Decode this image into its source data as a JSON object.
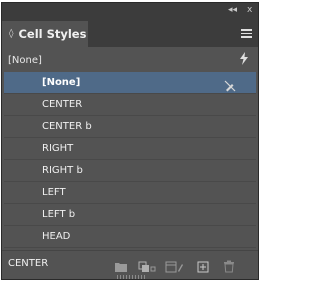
{
  "panel": {
    "title": "Cell Styles",
    "collapse_glyph": "◊",
    "topbar_collapse": "◂◂",
    "topbar_close": "x",
    "menu_icon": "panel-menu-icon"
  },
  "current_style": {
    "label": "[None]",
    "icon": "lightning-icon"
  },
  "styles": [
    {
      "label": "[None]",
      "selected": true,
      "icon": "pencil-disabled-icon"
    },
    {
      "label": "CENTER"
    },
    {
      "label": "CENTER b"
    },
    {
      "label": "RIGHT"
    },
    {
      "label": "RIGHT b"
    },
    {
      "label": "LEFT"
    },
    {
      "label": "LEFT b"
    },
    {
      "label": "HEAD"
    }
  ],
  "footer": {
    "label": "CENTER",
    "icons": [
      "folder-icon",
      "group-styles-icon",
      "clear-overrides-icon",
      "new-style-icon",
      "delete-icon"
    ]
  },
  "colors": {
    "panel_bg": "#535353",
    "selected_row": "#4f6a88",
    "header_bg": "#3c3c3c"
  }
}
